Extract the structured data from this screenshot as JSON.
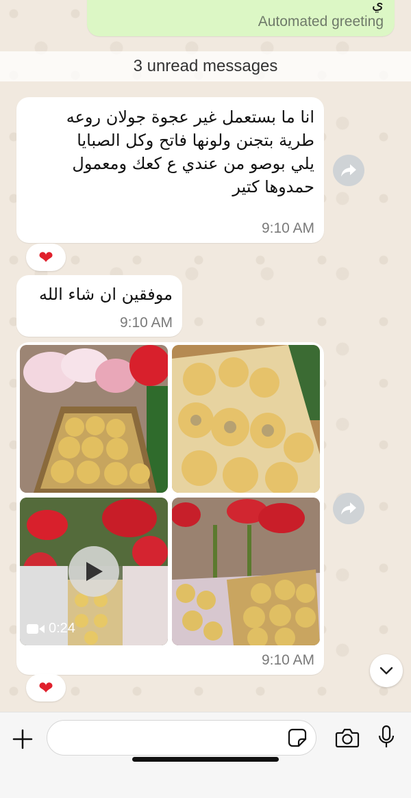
{
  "chat": {
    "outgoing_prev": {
      "top_text": "ي",
      "footer_text": "Automated greeting"
    },
    "unread_banner": "3 unread messages",
    "messages": [
      {
        "lines": [
          "انا ما  بستعمل غير عجوة جولان روعه",
          "طرية بتجنن ولونها فاتح وكل الصبايا",
          "يلي بوصو من عندي ع كعك ومعمول",
          "حمدوها كتير"
        ],
        "time": "9:10 AM",
        "reaction": "❤"
      },
      {
        "text": "موفقين ان شاء الله",
        "time": "9:10 AM"
      },
      {
        "video_duration": "0:24",
        "time": "9:10 AM",
        "reaction": "❤"
      }
    ]
  },
  "colors": {
    "outgoing_bubble": "#dcf7c5",
    "incoming_bubble": "#ffffff",
    "heart": "#e0202c"
  }
}
